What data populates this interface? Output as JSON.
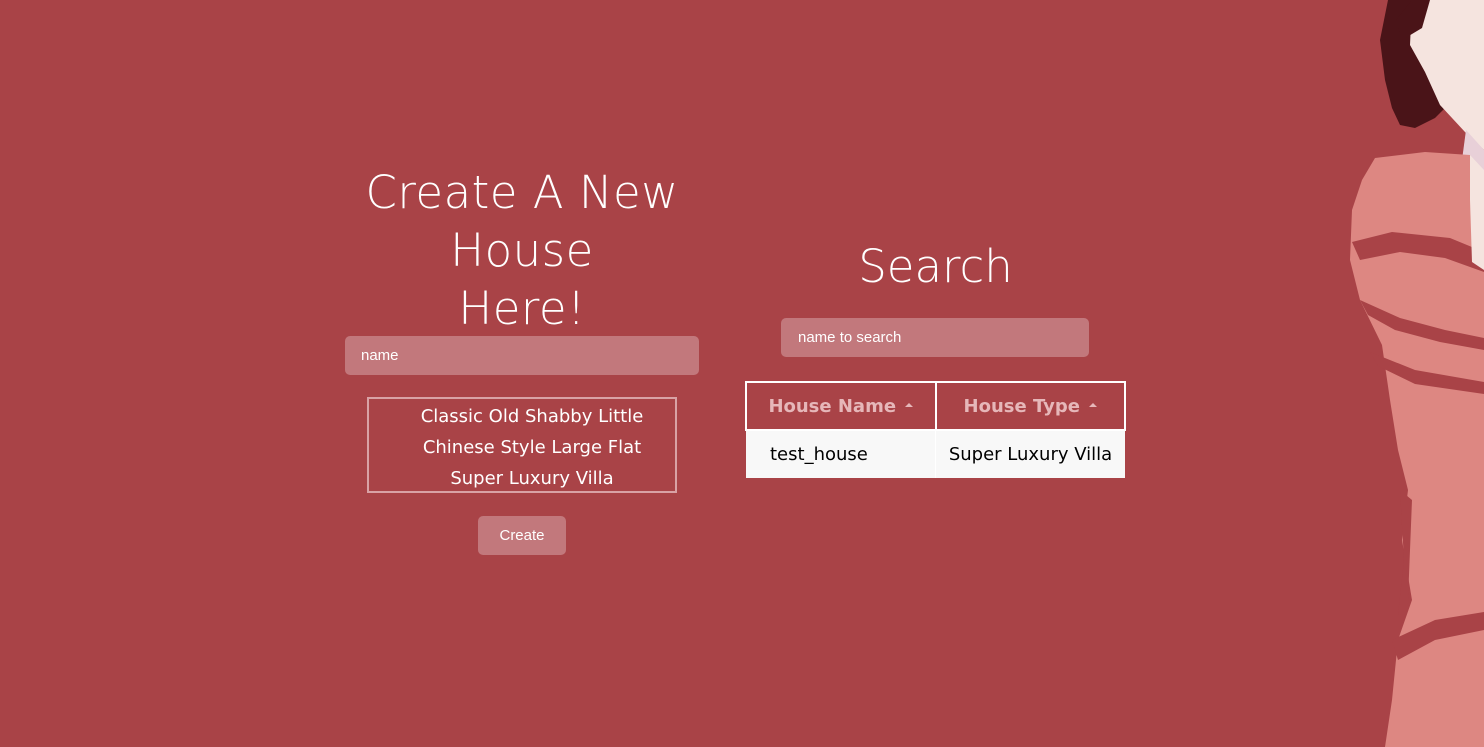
{
  "create": {
    "title_line1": "Create A New House",
    "title_line2": "Here!",
    "name_placeholder": "name",
    "house_types": [
      "Classic Old Shabby Little",
      "Chinese Style Large Flat",
      "Super Luxury Villa"
    ],
    "create_label": "Create"
  },
  "search": {
    "title": "Search",
    "placeholder": "name to search",
    "columns": [
      "House Name",
      "House Type"
    ],
    "rows": [
      {
        "name": "test_house",
        "type": "Super Luxury Villa"
      }
    ]
  },
  "colors": {
    "background": "#a94347",
    "input_fill": "#c2787c",
    "header_text": "#e6b7b9",
    "row_background": "#f8f8f8",
    "art_skin": "#f5e4df",
    "art_hair": "#4a1418",
    "art_cloth": "#dd8782"
  },
  "icons": {
    "sort": "triangle-up-icon",
    "decoration": "anime-character-illustration"
  }
}
